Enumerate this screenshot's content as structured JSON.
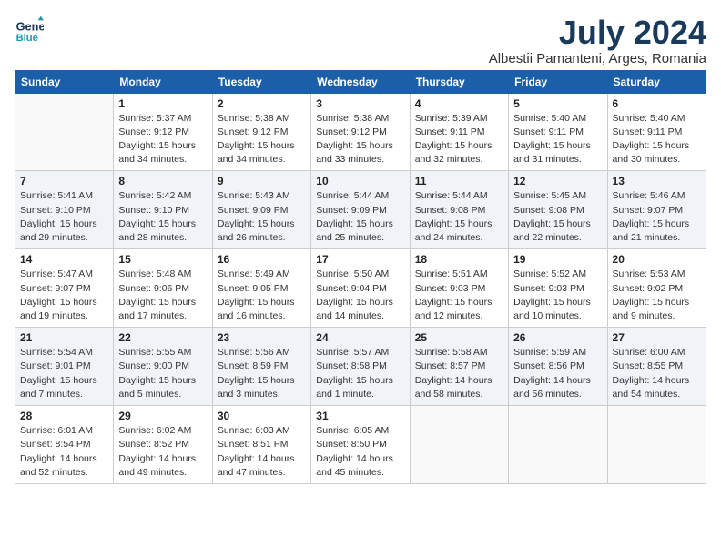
{
  "header": {
    "logo_line1": "General",
    "logo_line2": "Blue",
    "month": "July 2024",
    "location": "Albestii Pamanteni, Arges, Romania"
  },
  "weekdays": [
    "Sunday",
    "Monday",
    "Tuesday",
    "Wednesday",
    "Thursday",
    "Friday",
    "Saturday"
  ],
  "weeks": [
    [
      {
        "num": "",
        "info": ""
      },
      {
        "num": "1",
        "info": "Sunrise: 5:37 AM\nSunset: 9:12 PM\nDaylight: 15 hours\nand 34 minutes."
      },
      {
        "num": "2",
        "info": "Sunrise: 5:38 AM\nSunset: 9:12 PM\nDaylight: 15 hours\nand 34 minutes."
      },
      {
        "num": "3",
        "info": "Sunrise: 5:38 AM\nSunset: 9:12 PM\nDaylight: 15 hours\nand 33 minutes."
      },
      {
        "num": "4",
        "info": "Sunrise: 5:39 AM\nSunset: 9:11 PM\nDaylight: 15 hours\nand 32 minutes."
      },
      {
        "num": "5",
        "info": "Sunrise: 5:40 AM\nSunset: 9:11 PM\nDaylight: 15 hours\nand 31 minutes."
      },
      {
        "num": "6",
        "info": "Sunrise: 5:40 AM\nSunset: 9:11 PM\nDaylight: 15 hours\nand 30 minutes."
      }
    ],
    [
      {
        "num": "7",
        "info": "Sunrise: 5:41 AM\nSunset: 9:10 PM\nDaylight: 15 hours\nand 29 minutes."
      },
      {
        "num": "8",
        "info": "Sunrise: 5:42 AM\nSunset: 9:10 PM\nDaylight: 15 hours\nand 28 minutes."
      },
      {
        "num": "9",
        "info": "Sunrise: 5:43 AM\nSunset: 9:09 PM\nDaylight: 15 hours\nand 26 minutes."
      },
      {
        "num": "10",
        "info": "Sunrise: 5:44 AM\nSunset: 9:09 PM\nDaylight: 15 hours\nand 25 minutes."
      },
      {
        "num": "11",
        "info": "Sunrise: 5:44 AM\nSunset: 9:08 PM\nDaylight: 15 hours\nand 24 minutes."
      },
      {
        "num": "12",
        "info": "Sunrise: 5:45 AM\nSunset: 9:08 PM\nDaylight: 15 hours\nand 22 minutes."
      },
      {
        "num": "13",
        "info": "Sunrise: 5:46 AM\nSunset: 9:07 PM\nDaylight: 15 hours\nand 21 minutes."
      }
    ],
    [
      {
        "num": "14",
        "info": "Sunrise: 5:47 AM\nSunset: 9:07 PM\nDaylight: 15 hours\nand 19 minutes."
      },
      {
        "num": "15",
        "info": "Sunrise: 5:48 AM\nSunset: 9:06 PM\nDaylight: 15 hours\nand 17 minutes."
      },
      {
        "num": "16",
        "info": "Sunrise: 5:49 AM\nSunset: 9:05 PM\nDaylight: 15 hours\nand 16 minutes."
      },
      {
        "num": "17",
        "info": "Sunrise: 5:50 AM\nSunset: 9:04 PM\nDaylight: 15 hours\nand 14 minutes."
      },
      {
        "num": "18",
        "info": "Sunrise: 5:51 AM\nSunset: 9:03 PM\nDaylight: 15 hours\nand 12 minutes."
      },
      {
        "num": "19",
        "info": "Sunrise: 5:52 AM\nSunset: 9:03 PM\nDaylight: 15 hours\nand 10 minutes."
      },
      {
        "num": "20",
        "info": "Sunrise: 5:53 AM\nSunset: 9:02 PM\nDaylight: 15 hours\nand 9 minutes."
      }
    ],
    [
      {
        "num": "21",
        "info": "Sunrise: 5:54 AM\nSunset: 9:01 PM\nDaylight: 15 hours\nand 7 minutes."
      },
      {
        "num": "22",
        "info": "Sunrise: 5:55 AM\nSunset: 9:00 PM\nDaylight: 15 hours\nand 5 minutes."
      },
      {
        "num": "23",
        "info": "Sunrise: 5:56 AM\nSunset: 8:59 PM\nDaylight: 15 hours\nand 3 minutes."
      },
      {
        "num": "24",
        "info": "Sunrise: 5:57 AM\nSunset: 8:58 PM\nDaylight: 15 hours\nand 1 minute."
      },
      {
        "num": "25",
        "info": "Sunrise: 5:58 AM\nSunset: 8:57 PM\nDaylight: 14 hours\nand 58 minutes."
      },
      {
        "num": "26",
        "info": "Sunrise: 5:59 AM\nSunset: 8:56 PM\nDaylight: 14 hours\nand 56 minutes."
      },
      {
        "num": "27",
        "info": "Sunrise: 6:00 AM\nSunset: 8:55 PM\nDaylight: 14 hours\nand 54 minutes."
      }
    ],
    [
      {
        "num": "28",
        "info": "Sunrise: 6:01 AM\nSunset: 8:54 PM\nDaylight: 14 hours\nand 52 minutes."
      },
      {
        "num": "29",
        "info": "Sunrise: 6:02 AM\nSunset: 8:52 PM\nDaylight: 14 hours\nand 49 minutes."
      },
      {
        "num": "30",
        "info": "Sunrise: 6:03 AM\nSunset: 8:51 PM\nDaylight: 14 hours\nand 47 minutes."
      },
      {
        "num": "31",
        "info": "Sunrise: 6:05 AM\nSunset: 8:50 PM\nDaylight: 14 hours\nand 45 minutes."
      },
      {
        "num": "",
        "info": ""
      },
      {
        "num": "",
        "info": ""
      },
      {
        "num": "",
        "info": ""
      }
    ]
  ]
}
